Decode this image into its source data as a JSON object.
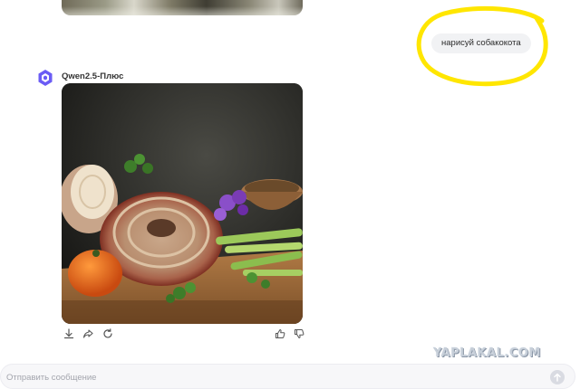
{
  "chat": {
    "user_message": "нарисуй собакокота",
    "assistant_name": "Qwen2.5-Плюс"
  },
  "composer": {
    "placeholder": "Отправить сообщение"
  },
  "watermark": "YAPLAKAL.COM",
  "icons": {
    "avatar": "qwen-logo-icon",
    "download": "download-icon",
    "share": "share-icon",
    "regenerate": "refresh-icon",
    "like": "thumbs-up-icon",
    "dislike": "thumbs-down-icon",
    "send": "arrow-up-icon"
  },
  "colors": {
    "accent": "#6b5cf5",
    "highlight": "#ffe600",
    "bubble": "#f1f2f4"
  }
}
